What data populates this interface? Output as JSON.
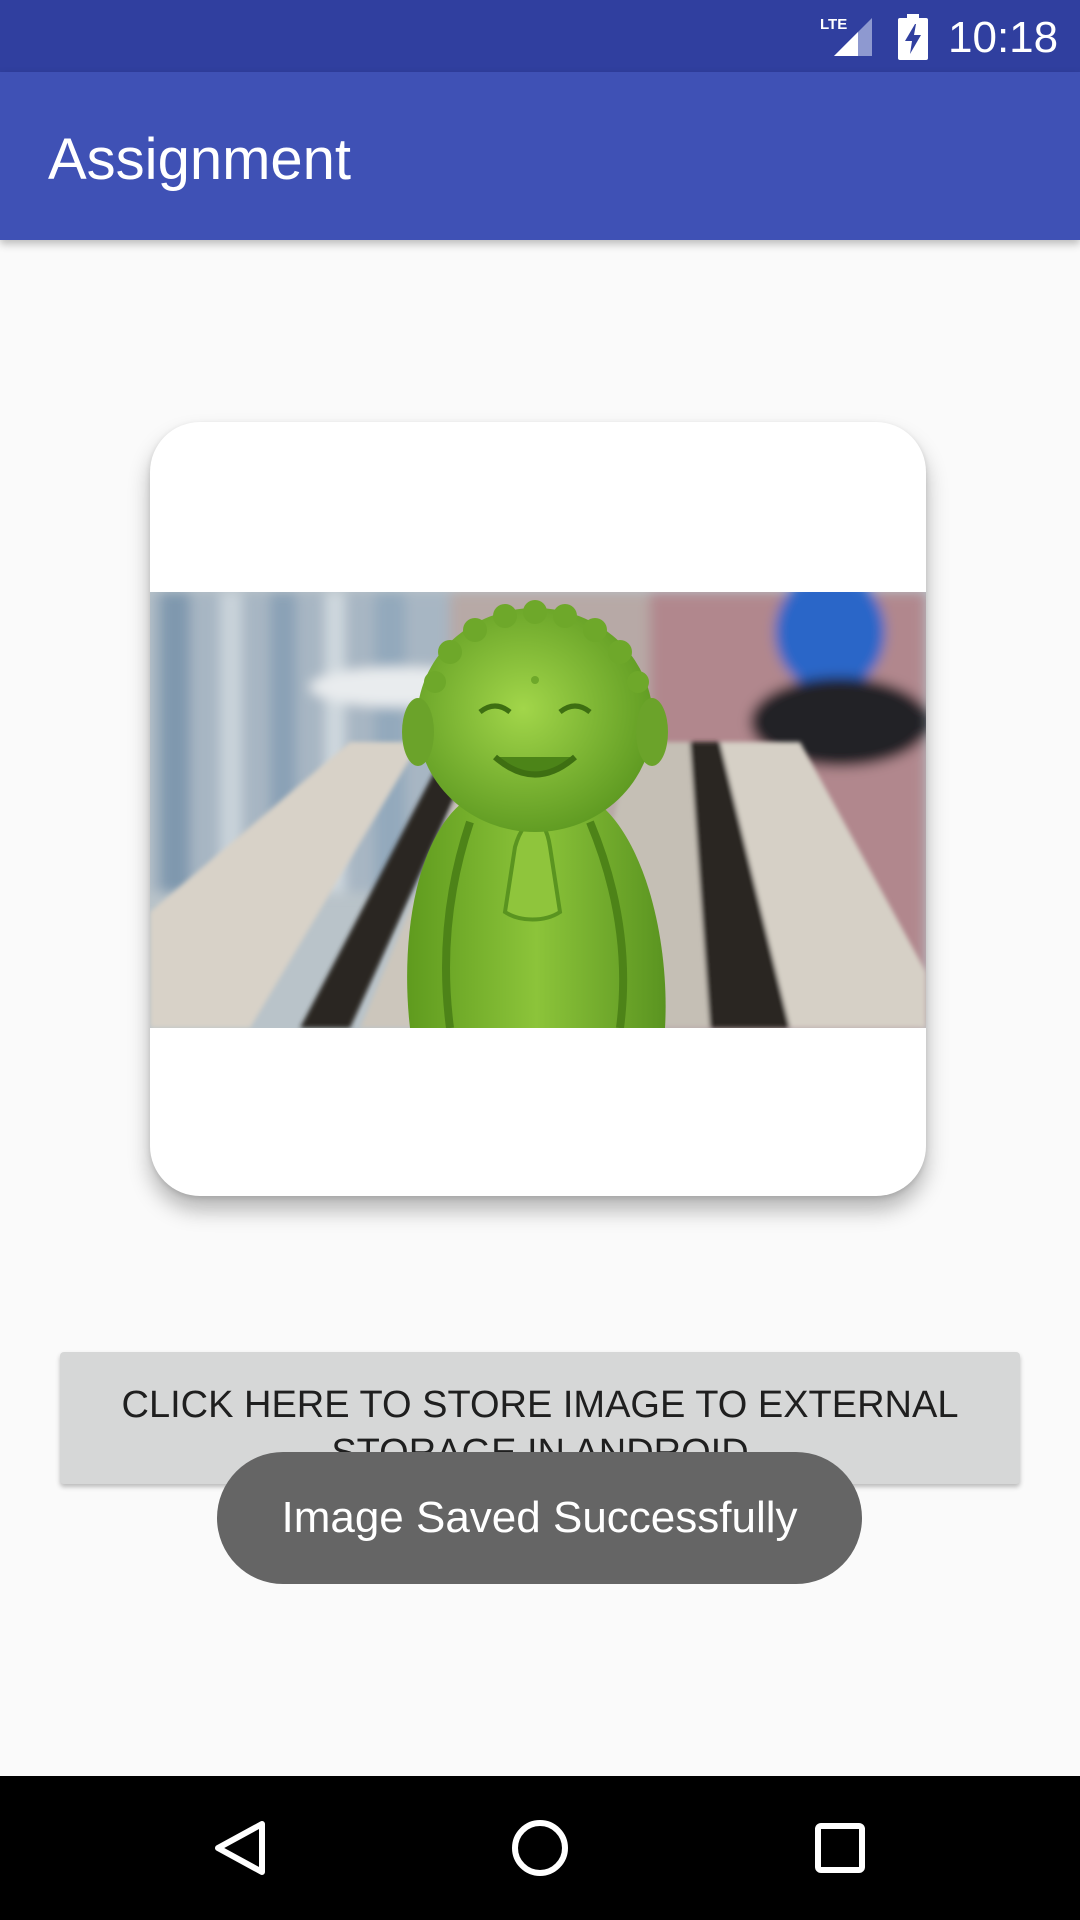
{
  "status_bar": {
    "network_label": "LTE",
    "time": "10:18",
    "icons": [
      "lte-signal-icon",
      "battery-charging-icon"
    ]
  },
  "app_bar": {
    "title": "Assignment"
  },
  "main": {
    "image": {
      "description_icon": "image-icon"
    },
    "store_button_label": "CLICK HERE TO STORE IMAGE TO EXTERNAL STORAGE IN ANDROID"
  },
  "toast": {
    "message": "Image Saved Successfully"
  },
  "nav_bar": {
    "icons": [
      "back-icon",
      "home-icon",
      "recents-icon"
    ]
  },
  "colors": {
    "status_bar": "#303f9f",
    "app_bar": "#3f51b5",
    "background": "#fafafa",
    "button": "#d6d7d7",
    "toast": "#656565",
    "nav_bar": "#000000"
  }
}
